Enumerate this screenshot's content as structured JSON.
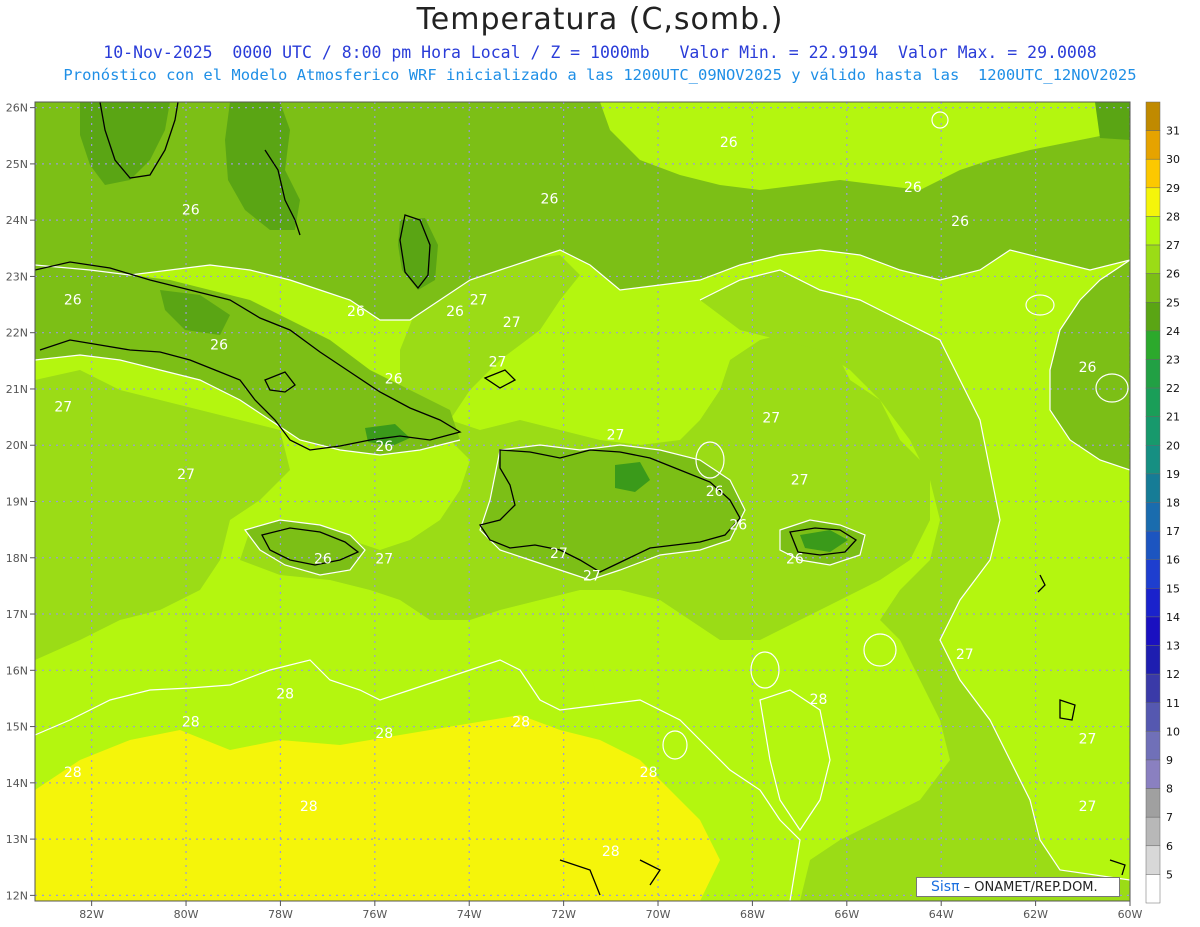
{
  "title": "Temperatura (C,somb.)",
  "subtitle1": "10-Nov-2025  0000 UTC / 8:00 pm Hora Local / Z = 1000mb   Valor Min. = 22.9194  Valor Max. = 29.0008",
  "subtitle2": "Pronóstico con el Modelo Atmosferico WRF inicializado a las 1200UTC_09NOV2025 y válido hasta las  1200UTC_12NOV2025",
  "credit": {
    "brand": "Sisπ",
    "text": " – ONAMET/REP.DOM."
  },
  "colors": {
    "c25": "#5aa514",
    "c26": "#7cbf16",
    "c27": "#9bdc16",
    "c28": "#b4f60f",
    "c29": "#f5f50a",
    "c24": "#3a9a1a",
    "coast": "#000000",
    "contour": "#ffffff",
    "grid": "#9a9ad8"
  },
  "map_data": {
    "lon_range": [
      -83.2,
      -60.0
    ],
    "lat_range": [
      11.9,
      26.1
    ],
    "lon_ticks": [
      "82W",
      "80W",
      "78W",
      "76W",
      "74W",
      "72W",
      "70W",
      "68W",
      "66W",
      "64W",
      "62W",
      "60W"
    ],
    "lat_ticks": [
      "12N",
      "13N",
      "14N",
      "15N",
      "16N",
      "17N",
      "18N",
      "19N",
      "20N",
      "21N",
      "22N",
      "23N",
      "24N",
      "25N",
      "26N"
    ],
    "contour_labels": [
      {
        "text": "26",
        "lon": -76.4,
        "lat": 22.3
      },
      {
        "text": "26",
        "lon": -79.3,
        "lat": 21.7
      },
      {
        "text": "26",
        "lon": -82.4,
        "lat": 22.5
      },
      {
        "text": "26",
        "lon": -75.6,
        "lat": 21.1
      },
      {
        "text": "26",
        "lon": -74.3,
        "lat": 22.3
      },
      {
        "text": "26",
        "lon": -79.9,
        "lat": 24.1
      },
      {
        "text": "26",
        "lon": -75.8,
        "lat": 19.9
      },
      {
        "text": "26",
        "lon": -72.3,
        "lat": 24.3
      },
      {
        "text": "26",
        "lon": -68.5,
        "lat": 25.3
      },
      {
        "text": "26",
        "lon": -64.6,
        "lat": 24.5
      },
      {
        "text": "26",
        "lon": -63.6,
        "lat": 23.9
      },
      {
        "text": "26",
        "lon": -60.9,
        "lat": 21.3
      },
      {
        "text": "26",
        "lon": -77.1,
        "lat": 17.9
      },
      {
        "text": "26",
        "lon": -68.8,
        "lat": 19.1
      },
      {
        "text": "26",
        "lon": -68.3,
        "lat": 18.5
      },
      {
        "text": "26",
        "lon": -67.1,
        "lat": 17.9
      },
      {
        "text": "27",
        "lon": -73.8,
        "lat": 22.5
      },
      {
        "text": "27",
        "lon": -73.1,
        "lat": 22.1
      },
      {
        "text": "27",
        "lon": -73.4,
        "lat": 21.4
      },
      {
        "text": "27",
        "lon": -70.9,
        "lat": 20.1
      },
      {
        "text": "27",
        "lon": -67.6,
        "lat": 20.4
      },
      {
        "text": "27",
        "lon": -67.0,
        "lat": 19.3
      },
      {
        "text": "27",
        "lon": -82.6,
        "lat": 20.6
      },
      {
        "text": "27",
        "lon": -80.0,
        "lat": 19.4
      },
      {
        "text": "27",
        "lon": -75.8,
        "lat": 17.9
      },
      {
        "text": "27",
        "lon": -72.1,
        "lat": 18.0
      },
      {
        "text": "27",
        "lon": -71.4,
        "lat": 17.6
      },
      {
        "text": "27",
        "lon": -63.5,
        "lat": 16.2
      },
      {
        "text": "27",
        "lon": -60.9,
        "lat": 14.7
      },
      {
        "text": "27",
        "lon": -60.9,
        "lat": 13.5
      },
      {
        "text": "28",
        "lon": -77.9,
        "lat": 15.5
      },
      {
        "text": "28",
        "lon": -79.9,
        "lat": 15.0
      },
      {
        "text": "28",
        "lon": -75.8,
        "lat": 14.8
      },
      {
        "text": "28",
        "lon": -72.9,
        "lat": 15.0
      },
      {
        "text": "28",
        "lon": -82.4,
        "lat": 14.1
      },
      {
        "text": "28",
        "lon": -77.4,
        "lat": 13.5
      },
      {
        "text": "28",
        "lon": -70.2,
        "lat": 14.1
      },
      {
        "text": "28",
        "lon": -66.6,
        "lat": 15.4
      },
      {
        "text": "28",
        "lon": -71.0,
        "lat": 12.7
      }
    ]
  },
  "legend": {
    "labels": [
      "31",
      "30",
      "29",
      "28",
      "27",
      "26",
      "25",
      "24",
      "23",
      "22",
      "21",
      "20",
      "19",
      "18",
      "17",
      "16",
      "15",
      "14",
      "13",
      "12",
      "11",
      "10",
      "9",
      "8",
      "7",
      "6",
      "5"
    ],
    "colors": [
      "#c08a00",
      "#e6a300",
      "#fcc800",
      "#f5f50a",
      "#b4f60f",
      "#9bdc16",
      "#7cbf16",
      "#5aa514",
      "#2ca92c",
      "#22a044",
      "#1a9e58",
      "#17996c",
      "#168f82",
      "#167c96",
      "#1a6cae",
      "#1c55c0",
      "#1e3ecf",
      "#1a22cc",
      "#1a10c0",
      "#1e1eb0",
      "#3a3aa8",
      "#5558b0",
      "#7070b8",
      "#8a80c0",
      "#a0a0a0",
      "#b8b8b8",
      "#d8d8d8",
      "#ffffff"
    ]
  }
}
